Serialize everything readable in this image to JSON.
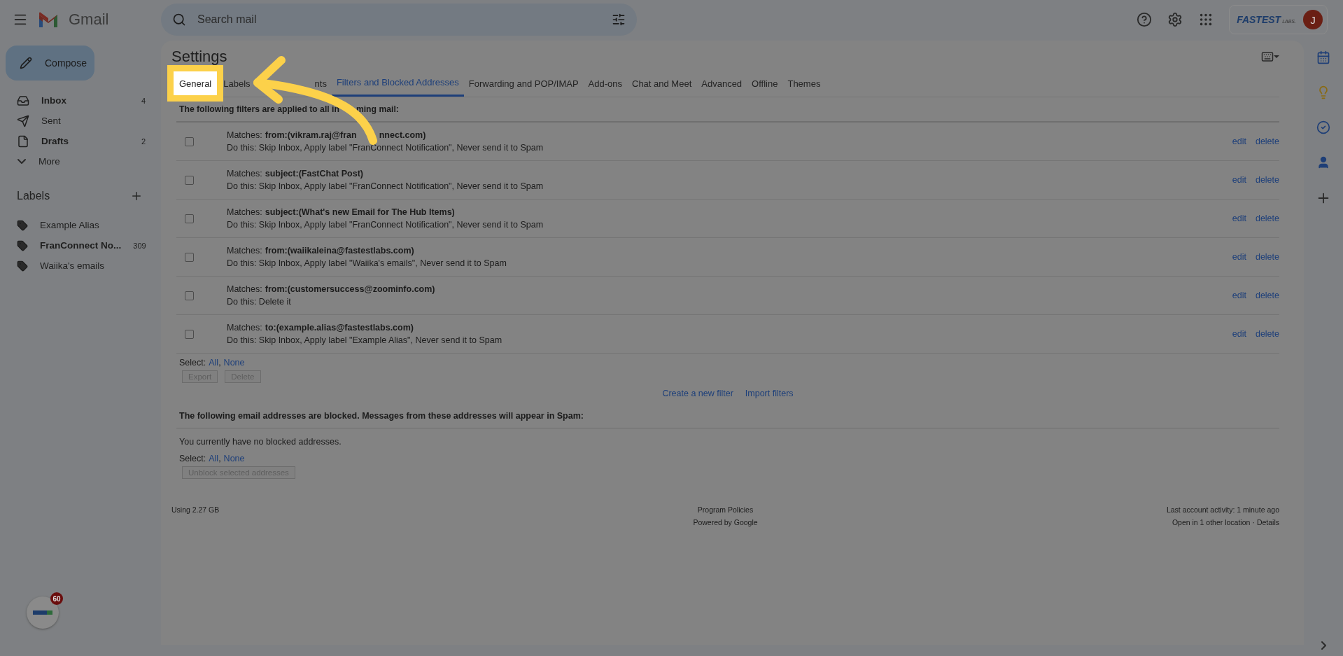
{
  "header": {
    "product": "Gmail",
    "search": {
      "placeholder": "Search mail"
    },
    "account": {
      "logo": "FASTEST",
      "logo_suffix": "LABS.",
      "avatar": "J"
    }
  },
  "sidebar": {
    "compose": "Compose",
    "items": [
      {
        "kind": "inbox",
        "label": "Inbox",
        "count": "4",
        "unread": true
      },
      {
        "kind": "sent",
        "label": "Sent",
        "unread": false
      },
      {
        "kind": "drafts",
        "label": "Drafts",
        "count": "2",
        "unread": true
      },
      {
        "kind": "more",
        "label": "More",
        "unread": false
      }
    ],
    "labels_title": "Labels",
    "labels": [
      {
        "label": "Example Alias",
        "unread": false
      },
      {
        "label": "FranConnect No...",
        "count": "309",
        "unread": true
      },
      {
        "label": "Waiika's emails",
        "unread": false
      }
    ]
  },
  "settings": {
    "title": "Settings",
    "tabs": [
      {
        "label": "General",
        "selected": false,
        "highlighted": true
      },
      {
        "label": "Labels",
        "selected": false,
        "highlighted": false
      },
      {
        "label": "nts",
        "selected": false,
        "highlighted": false
      },
      {
        "label": "Filters and Blocked Addresses",
        "selected": true,
        "highlighted": false
      },
      {
        "label": "Forwarding and POP/IMAP",
        "selected": false,
        "highlighted": false
      },
      {
        "label": "Add-ons",
        "selected": false,
        "highlighted": false
      },
      {
        "label": "Chat and Meet",
        "selected": false,
        "highlighted": false
      },
      {
        "label": "Advanced",
        "selected": false,
        "highlighted": false
      },
      {
        "label": "Offline",
        "selected": false,
        "highlighted": false
      },
      {
        "label": "Themes",
        "selected": false,
        "highlighted": false
      }
    ],
    "filters_heading": [
      "The following filters are applied to all in",
      "ming mail:"
    ],
    "filters": [
      {
        "match_label": "Matches:",
        "criteria": [
          "from:(vikram.raj@fran",
          "nnect.com)"
        ],
        "action": "Do this: Skip Inbox, Apply label \"FranConnect Notification\", Never send it to Spam",
        "edit": "edit",
        "delete": "delete",
        "checked": false
      },
      {
        "match_label": "Matches:",
        "criteria": [
          "subject:(FastChat Post)"
        ],
        "action": "Do this: Skip Inbox, Apply label \"FranConnect Notification\", Never send it to Spam",
        "edit": "edit",
        "delete": "delete",
        "checked": false
      },
      {
        "match_label": "Matches:",
        "criteria": [
          "subject:(What's new Email for The Hub Items)"
        ],
        "action": "Do this: Skip Inbox, Apply label \"FranConnect Notification\", Never send it to Spam",
        "edit": "edit",
        "delete": "delete",
        "checked": false
      },
      {
        "match_label": "Matches:",
        "criteria": [
          "from:(waiikaleina@fastestlabs.com)"
        ],
        "action": "Do this: Skip Inbox, Apply label \"Waiika's emails\", Never send it to Spam",
        "edit": "edit",
        "delete": "delete",
        "checked": false
      },
      {
        "match_label": "Matches:",
        "criteria": [
          "from:(customersuccess@zoominfo.com)"
        ],
        "action": "Do this: Delete it",
        "edit": "edit",
        "delete": "delete",
        "checked": false
      },
      {
        "match_label": "Matches:",
        "criteria": [
          "to:(example.alias@fastestlabs.com)"
        ],
        "action": "Do this: Skip Inbox, Apply label \"Example Alias\", Never send it to Spam",
        "edit": "edit",
        "delete": "delete",
        "checked": false
      }
    ],
    "filters_select": {
      "label": "Select:",
      "all": "All",
      "comma": ",",
      "none": "None"
    },
    "filter_buttons": [
      {
        "label": "Export",
        "disabled": true
      },
      {
        "label": "Delete",
        "disabled": true
      }
    ],
    "filter_links": [
      "Create a new filter",
      "Import filters"
    ],
    "blocked_heading": "The following email addresses are blocked. Messages from these addresses will appear in Spam:",
    "blocked_empty": "You currently have no blocked addresses.",
    "blocked_select": {
      "label": "Select:",
      "all": "All",
      "comma": ",",
      "none": "None"
    },
    "blocked_button": {
      "label": "Unblock selected addresses",
      "disabled": true
    }
  },
  "footer": {
    "storage": "Using 2.27 GB",
    "center": [
      "Program Policies",
      "Powered by Google"
    ],
    "activity": "Last account activity: 1 minute ago",
    "location": "Open in 1 other location",
    "separator": "·",
    "details": "Details"
  },
  "badge": {
    "count": "60"
  }
}
